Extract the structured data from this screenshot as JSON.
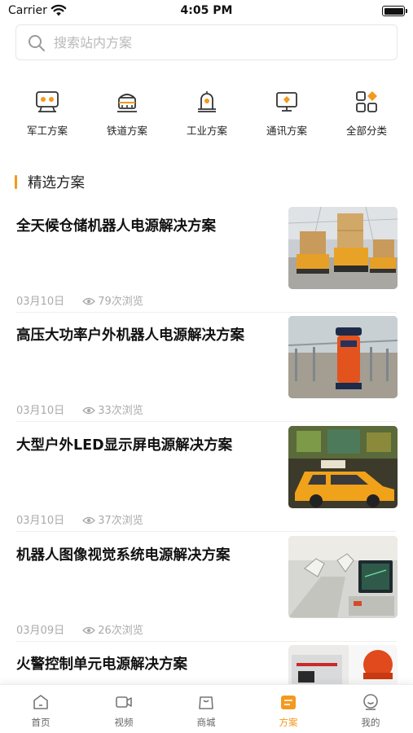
{
  "status_bar": {
    "carrier": "Carrier",
    "time": "4:05 PM"
  },
  "search": {
    "placeholder": "搜索站内方案"
  },
  "categories": [
    {
      "label": "军工方案",
      "icon": "military-icon"
    },
    {
      "label": "铁道方案",
      "icon": "railway-icon"
    },
    {
      "label": "工业方案",
      "icon": "industrial-icon"
    },
    {
      "label": "通讯方案",
      "icon": "communication-icon"
    },
    {
      "label": "全部分类",
      "icon": "all-categories-icon"
    }
  ],
  "section": {
    "title": "精选方案"
  },
  "articles": [
    {
      "title": "全天候仓储机器人电源解决方案",
      "date": "03月10日",
      "views": "79次浏览",
      "image": "warehouse-robot-image"
    },
    {
      "title": "高压大功率户外机器人电源解决方案",
      "date": "03月10日",
      "views": "33次浏览",
      "image": "outdoor-robot-image"
    },
    {
      "title": "大型户外LED显示屏电源解决方案",
      "date": "03月10日",
      "views": "37次浏览",
      "image": "led-display-taxi-image"
    },
    {
      "title": "机器人图像视觉系统电源解决方案",
      "date": "03月09日",
      "views": "26次浏览",
      "image": "vision-system-image"
    },
    {
      "title": "火警控制单元电源解决方案",
      "date": "",
      "views": "",
      "image": "fire-alarm-image"
    }
  ],
  "tab_bar": {
    "tabs": [
      {
        "label": "首页",
        "icon": "home-icon"
      },
      {
        "label": "视频",
        "icon": "video-icon"
      },
      {
        "label": "商城",
        "icon": "shop-icon"
      },
      {
        "label": "方案",
        "icon": "solution-icon"
      },
      {
        "label": "我的",
        "icon": "profile-icon"
      }
    ],
    "active": "方案"
  },
  "colors": {
    "accent": "#f39a1e",
    "text": "#222222",
    "muted": "#aaaaaa"
  }
}
